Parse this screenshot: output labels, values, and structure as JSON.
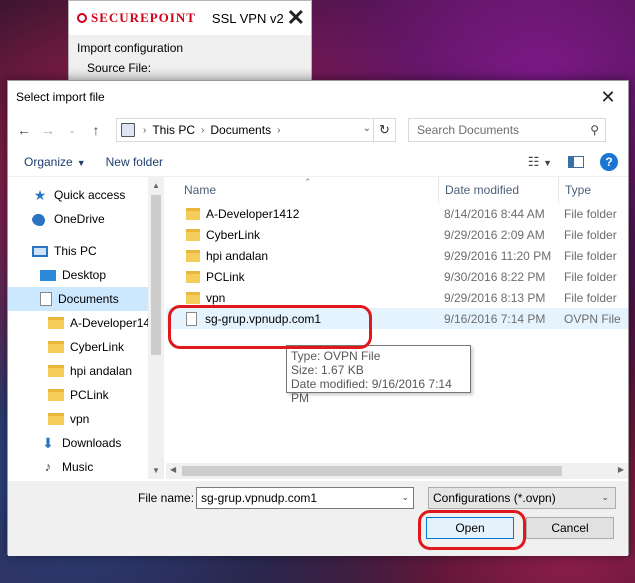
{
  "background_app": {
    "brand": "SECUREPOINT",
    "title": "SSL VPN v2",
    "heading": "Import configuration",
    "section": "Source File:"
  },
  "dialog": {
    "title": "Select import file",
    "breadcrumb": [
      "This PC",
      "Documents"
    ],
    "search_placeholder": "Search Documents",
    "toolbar": {
      "organize": "Organize",
      "new_folder": "New folder"
    },
    "nav": [
      {
        "label": "Quick access",
        "icon": "star-icon"
      },
      {
        "label": "OneDrive",
        "icon": "cloud-icon"
      },
      {
        "label": "This PC",
        "icon": "computer-icon"
      },
      {
        "label": "Desktop",
        "icon": "desktop-icon"
      },
      {
        "label": "Documents",
        "icon": "documents-icon",
        "selected": true
      },
      {
        "label": "A-Developer14",
        "icon": "folder-icon"
      },
      {
        "label": "CyberLink",
        "icon": "folder-icon"
      },
      {
        "label": "hpi andalan",
        "icon": "folder-icon"
      },
      {
        "label": "PCLink",
        "icon": "folder-icon"
      },
      {
        "label": "vpn",
        "icon": "folder-icon"
      },
      {
        "label": "Downloads",
        "icon": "download-icon"
      },
      {
        "label": "Music",
        "icon": "music-icon"
      }
    ],
    "columns": {
      "name": "Name",
      "date": "Date modified",
      "type": "Type"
    },
    "files": [
      {
        "name": "A-Developer1412",
        "date": "8/14/2016 8:44 AM",
        "type": "File folder",
        "kind": "folder"
      },
      {
        "name": "CyberLink",
        "date": "9/29/2016 2:09 AM",
        "type": "File folder",
        "kind": "folder"
      },
      {
        "name": "hpi andalan",
        "date": "9/29/2016 11:20 PM",
        "type": "File folder",
        "kind": "folder"
      },
      {
        "name": "PCLink",
        "date": "9/30/2016 8:22 PM",
        "type": "File folder",
        "kind": "folder"
      },
      {
        "name": "vpn",
        "date": "9/29/2016 8:13 PM",
        "type": "File folder",
        "kind": "folder"
      },
      {
        "name": "sg-grup.vpnudp.com1",
        "date": "9/16/2016 7:14 PM",
        "type": "OVPN File",
        "kind": "file"
      }
    ],
    "tooltip": {
      "type": "Type: OVPN File",
      "size": "Size: 1.67 KB",
      "date": "Date modified: 9/16/2016 7:14 PM"
    },
    "file_name_label": "File name:",
    "file_name_value": "sg-grup.vpnudp.com1",
    "filter_value": "Configurations (*.ovpn)",
    "open_label": "Open",
    "cancel_label": "Cancel"
  },
  "colors": {
    "selection": "#cce8ff",
    "hover": "#e5f3ff",
    "annotation": "#e0181b",
    "accent": "#0078d7"
  }
}
